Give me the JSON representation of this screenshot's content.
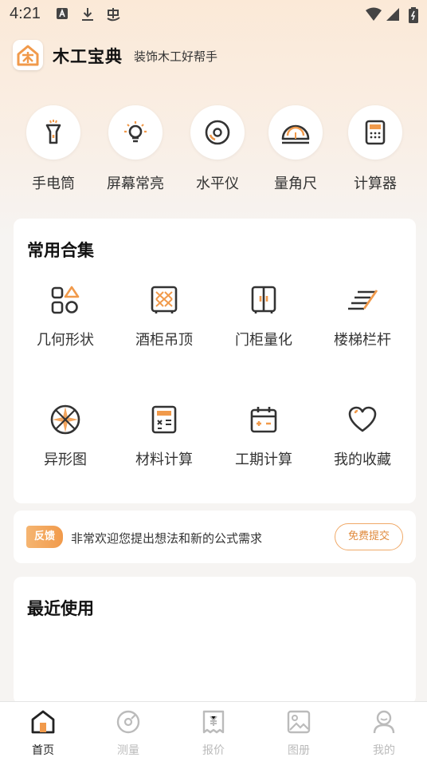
{
  "status_bar": {
    "time": "4:21"
  },
  "header": {
    "title": "木工宝典",
    "subtitle": "装饰木工好帮手"
  },
  "tools": [
    {
      "label": "手电筒",
      "icon": "flashlight-icon"
    },
    {
      "label": "屏幕常亮",
      "icon": "bulb-icon"
    },
    {
      "label": "水平仪",
      "icon": "level-icon"
    },
    {
      "label": "量角尺",
      "icon": "protractor-icon"
    },
    {
      "label": "计算器",
      "icon": "calculator-icon"
    }
  ],
  "collection": {
    "title": "常用合集",
    "items": [
      {
        "label": "几何形状",
        "icon": "shapes-icon"
      },
      {
        "label": "酒柜吊顶",
        "icon": "wine-cabinet-icon"
      },
      {
        "label": "门柜量化",
        "icon": "door-cabinet-icon"
      },
      {
        "label": "楼梯栏杆",
        "icon": "stairs-icon"
      },
      {
        "label": "异形图",
        "icon": "irregular-shape-icon"
      },
      {
        "label": "材料计算",
        "icon": "material-calc-icon"
      },
      {
        "label": "工期计算",
        "icon": "schedule-icon"
      },
      {
        "label": "我的收藏",
        "icon": "heart-icon"
      }
    ]
  },
  "feedback": {
    "badge": "反馈",
    "text": "非常欢迎您提出想法和新的公式需求",
    "button": "免费提交"
  },
  "recent": {
    "title": "最近使用"
  },
  "tabbar": {
    "items": [
      {
        "label": "首页",
        "active": true,
        "icon": "home-icon"
      },
      {
        "label": "测量",
        "active": false,
        "icon": "measure-icon"
      },
      {
        "label": "报价",
        "active": false,
        "icon": "quote-icon"
      },
      {
        "label": "图册",
        "active": false,
        "icon": "album-icon"
      },
      {
        "label": "我的",
        "active": false,
        "icon": "profile-icon"
      }
    ]
  },
  "colors": {
    "accent": "#f19a4b",
    "dark": "#333333",
    "background": "#f6f4f2"
  }
}
